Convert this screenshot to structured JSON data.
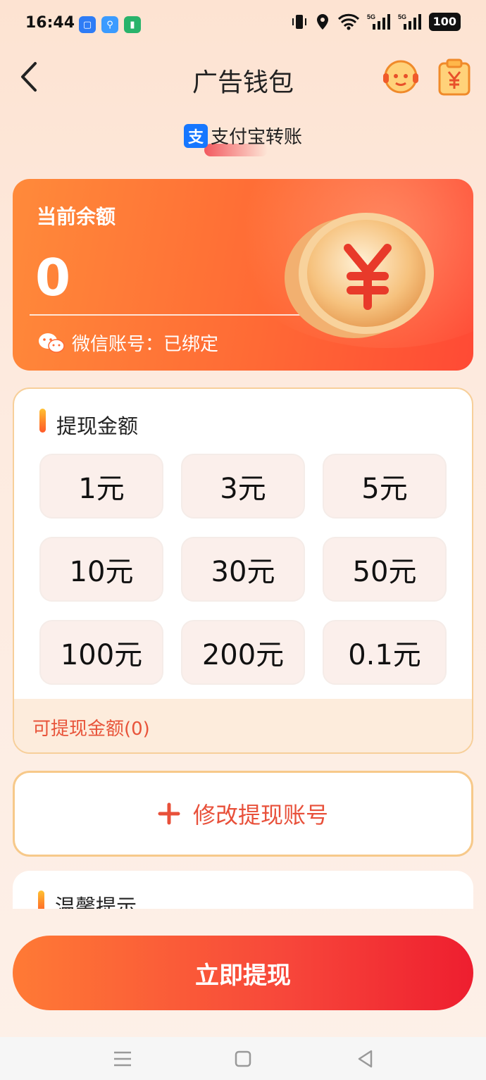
{
  "status_bar": {
    "time": "16:44",
    "signal_1": "5G",
    "signal_2": "5G",
    "battery": "100"
  },
  "header": {
    "title": "广告钱包"
  },
  "pay_method": {
    "logo_text": "支",
    "label": "支付宝转账"
  },
  "balance_card": {
    "label": "当前余额",
    "value": "0",
    "wechat_status": "微信账号：已绑定",
    "coin_symbol": "¥"
  },
  "amount_section": {
    "title": "提现金额",
    "options": [
      "1元",
      "3元",
      "5元",
      "10元",
      "30元",
      "50元",
      "100元",
      "200元",
      "0.1元"
    ],
    "available": "可提现金额(0)"
  },
  "modify_account": {
    "plus": "+",
    "label": "修改提现账号"
  },
  "tips": {
    "title": "温馨提示"
  },
  "withdraw": {
    "label": "立即提现"
  },
  "colors": {
    "accent_orange": "#ff6a35",
    "accent_red": "#ee1e2f",
    "text_red": "#e8503a",
    "option_bg": "#fbefeb"
  }
}
